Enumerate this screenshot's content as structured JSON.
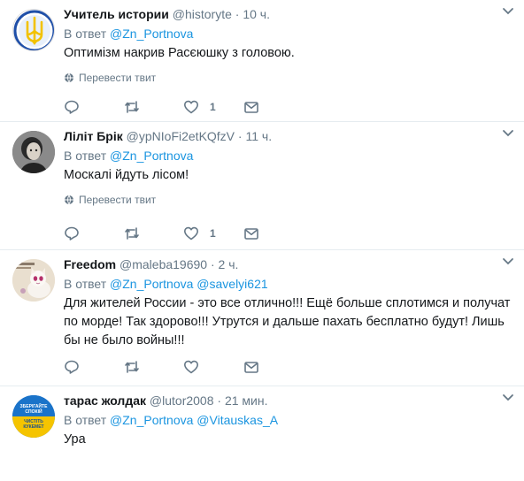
{
  "labels": {
    "reply_prefix": "В ответ"
  },
  "colors": {
    "accent": "#1b95e0",
    "muted": "#657786",
    "text": "#14171a",
    "divider": "#e6ecf0"
  },
  "tweets": [
    {
      "name": "Учитель истории",
      "handle": "@historyte",
      "time": "10 ч.",
      "mentions": "@Zn_Portnova",
      "text": "Оптимізм накрив Расєюшку з головою.",
      "translate": "Перевести твит",
      "likes": "1",
      "avatar": "trident-emblem"
    },
    {
      "name": "Ліліт Брік",
      "handle": "@ypNIoFi2etKQfzV",
      "time": "11 ч.",
      "mentions": "@Zn_Portnova",
      "text": "Москалі йдуть лісом!",
      "translate": "Перевести твит",
      "likes": "1",
      "avatar": "portrait-photo"
    },
    {
      "name": "Freedom",
      "handle": "@maleba19690",
      "time": "2 ч.",
      "mentions": "@Zn_Portnova @savelyi621",
      "text": "Для жителей России - это все отлично!!! Ещё больше сплотимся и получат по морде! Так здорово!!! Утрутся и дальше пахать бесплатно будут! Лишь бы не было войны!!!",
      "avatar": "cat-image"
    },
    {
      "name": "тарас жолдак",
      "handle": "@lutor2008",
      "time": "21 мин.",
      "mentions": "@Zn_Portnova @Vitauskas_A",
      "text": "Ура",
      "avatar": "calm-badge",
      "avatar_text_top": "ЗБЕРІГАЙТЕ СПОКІЙ",
      "avatar_text_bottom": "ЧИСТІТЬ КУКЕМЕТ"
    }
  ]
}
